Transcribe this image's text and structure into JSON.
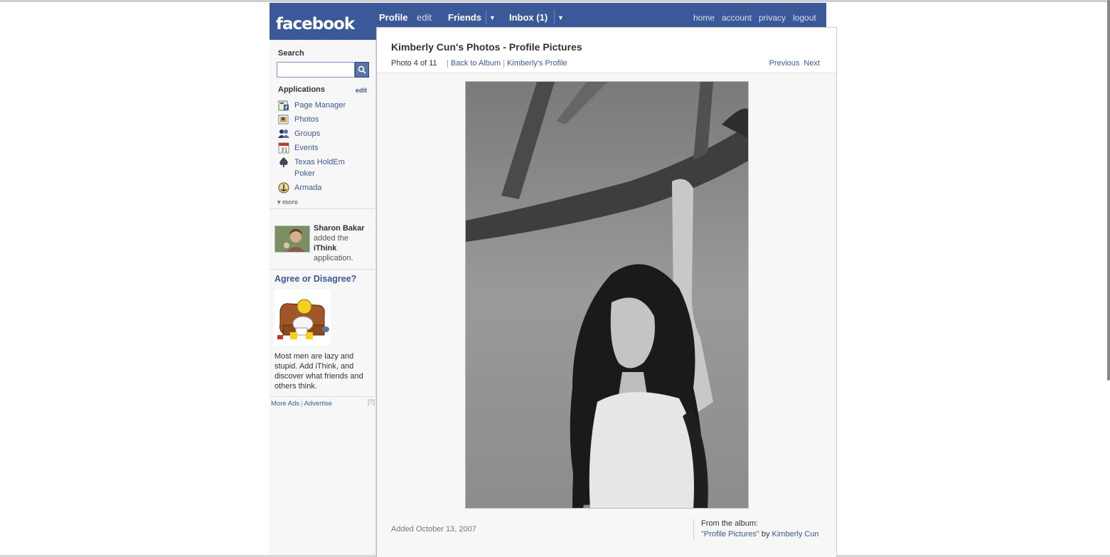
{
  "brand": {
    "logo": "facebook"
  },
  "nav": {
    "profile": "Profile",
    "edit": "edit",
    "friends": "Friends",
    "inbox": "Inbox (1)",
    "dropdown_glyph": "▼",
    "home": "home",
    "account": "account",
    "privacy": "privacy",
    "logout": "logout"
  },
  "sidebar": {
    "search_label": "Search",
    "search_value": "",
    "applications_label": "Applications",
    "applications_edit": "edit",
    "apps": [
      {
        "label": "Page Manager",
        "icon": "page-manager-icon"
      },
      {
        "label": "Photos",
        "icon": "photos-icon"
      },
      {
        "label": "Groups",
        "icon": "groups-icon"
      },
      {
        "label": "Events",
        "icon": "events-icon"
      },
      {
        "label": "Texas HoldEm Poker",
        "icon": "poker-icon"
      },
      {
        "label": "Armada",
        "icon": "armada-icon"
      }
    ],
    "more": "more",
    "feed": {
      "name": "Sharon Bakar",
      "text1": "added the",
      "app": "iThink",
      "text2": "application."
    },
    "ad": {
      "title": "Agree or Disagree?",
      "body": "Most men are lazy and stupid. Add iThink, and discover what friends and others think."
    },
    "footer": {
      "more_ads": "More Ads",
      "advertise": "Advertise",
      "help": "[?]"
    }
  },
  "photo_page": {
    "title": "Kimberly Cun's Photos - Profile Pictures",
    "photo_count": "Photo 4 of 11",
    "back_to_album": "Back to Album",
    "profile_link": "Kimberly's Profile",
    "previous": "Previous",
    "next": "Next",
    "added": "Added October 13, 2007",
    "from_album_label": "From the album:",
    "album_name": "\"Profile Pictures\"",
    "by": "by",
    "owner": "Kimberly Cun"
  },
  "colors": {
    "brand_blue": "#3b5998",
    "link_blue": "#3b5998",
    "sidebar_bg": "#f7f7f7"
  }
}
